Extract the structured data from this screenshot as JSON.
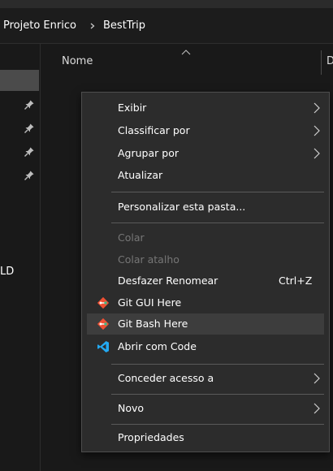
{
  "breadcrumb": {
    "items": [
      "Projeto Enrico",
      "BestTrip"
    ],
    "separator_icon": "chevron-right-icon"
  },
  "nav": {
    "truncated_label": "LD",
    "pin_icon": "pin-icon"
  },
  "file_list": {
    "columns": [
      "Nome",
      "D"
    ],
    "sort_icon": "sort-ascending-icon"
  },
  "context_menu": {
    "items": [
      {
        "label": "Exibir",
        "has_submenu": true
      },
      {
        "label": "Classificar por",
        "has_submenu": true
      },
      {
        "label": "Agrupar por",
        "has_submenu": true
      },
      {
        "label": "Atualizar"
      },
      {
        "label": "Personalizar esta pasta..."
      },
      {
        "label": "Colar",
        "disabled": true
      },
      {
        "label": "Colar atalho",
        "disabled": true
      },
      {
        "label": "Desfazer Renomear",
        "shortcut": "Ctrl+Z"
      },
      {
        "label": "Git GUI Here",
        "icon": "git-icon"
      },
      {
        "label": "Git Bash Here",
        "icon": "git-icon",
        "hovered": true
      },
      {
        "label": "Abrir com Code",
        "icon": "vscode-icon"
      },
      {
        "label": "Conceder acesso a",
        "has_submenu": true
      },
      {
        "label": "Novo",
        "has_submenu": true
      },
      {
        "label": "Propriedades"
      }
    ]
  },
  "colors": {
    "menu_background": "#2c2c2c",
    "menu_hover": "#3d3d3d",
    "git_icon": "#f05033",
    "git_icon_accent": "#42b883",
    "vscode_icon": "#23a9f2",
    "disabled_text": "#767676"
  }
}
